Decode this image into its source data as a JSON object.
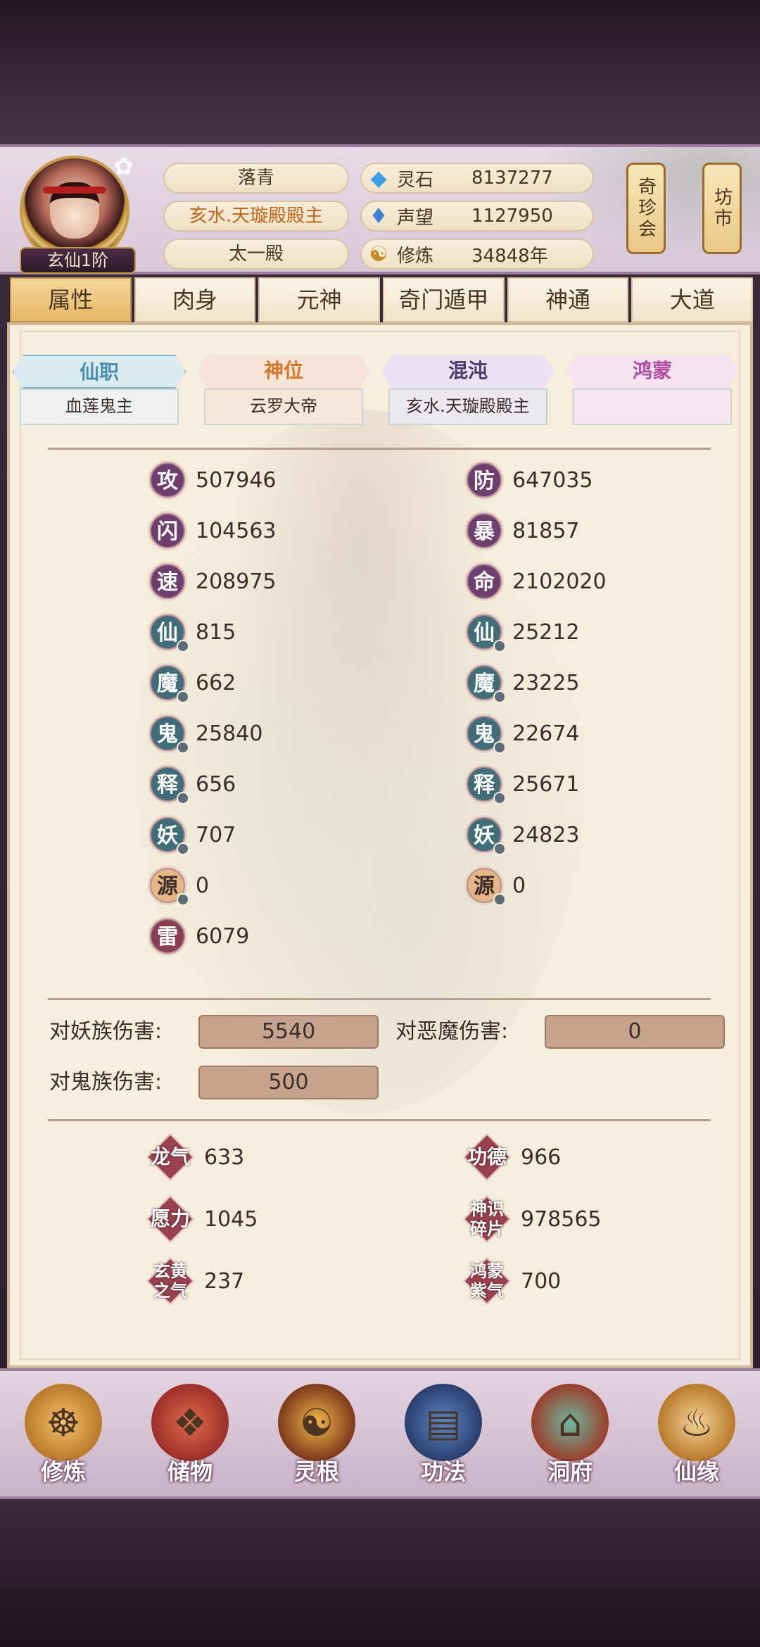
{
  "player": {
    "rank": "玄仙1阶",
    "name": "落青",
    "title": "亥水.天璇殿殿主",
    "faction": "太一殿"
  },
  "resources": [
    {
      "icon": "spirit-stone-icon",
      "label": "灵石",
      "value": "8137277"
    },
    {
      "icon": "reputation-icon",
      "label": "声望",
      "value": "1127950"
    },
    {
      "icon": "cultivation-icon",
      "label": "修炼",
      "value": "34848年"
    }
  ],
  "side_buttons": {
    "treasure": "奇珍会",
    "market": "坊市"
  },
  "tabs": [
    "属性",
    "肉身",
    "元神",
    "奇门遁甲",
    "神通",
    "大道"
  ],
  "titles": [
    {
      "label": "仙职",
      "value": "血莲鬼主"
    },
    {
      "label": "神位",
      "value": "云罗大帝"
    },
    {
      "label": "混沌",
      "value": "亥水.天璇殿殿主"
    },
    {
      "label": "鸿蒙",
      "value": ""
    }
  ],
  "stats_left": [
    {
      "char": "攻",
      "value": "507946"
    },
    {
      "char": "闪",
      "value": "104563"
    },
    {
      "char": "速",
      "value": "208975"
    },
    {
      "char": "仙",
      "value": "815"
    },
    {
      "char": "魔",
      "value": "662"
    },
    {
      "char": "鬼",
      "value": "25840"
    },
    {
      "char": "释",
      "value": "656"
    },
    {
      "char": "妖",
      "value": "707"
    },
    {
      "char": "源",
      "value": "0"
    },
    {
      "char": "雷",
      "value": "6079"
    }
  ],
  "stats_right": [
    {
      "char": "防",
      "value": "647035"
    },
    {
      "char": "暴",
      "value": "81857"
    },
    {
      "char": "命",
      "value": "2102020"
    },
    {
      "char": "仙",
      "value": "25212"
    },
    {
      "char": "魔",
      "value": "23225"
    },
    {
      "char": "鬼",
      "value": "22674"
    },
    {
      "char": "释",
      "value": "25671"
    },
    {
      "char": "妖",
      "value": "24823"
    },
    {
      "char": "源",
      "value": "0"
    }
  ],
  "damage": {
    "demon_race_label": "对妖族伤害:",
    "demon_race_value": "5540",
    "evil_demon_label": "对恶魔伤害:",
    "evil_demon_value": "0",
    "ghost_race_label": "对鬼族伤害:",
    "ghost_race_value": "500"
  },
  "misc": [
    {
      "label": "龙气",
      "value": "633"
    },
    {
      "label": "功德",
      "value": "966"
    },
    {
      "label": "愿力",
      "value": "1045"
    },
    {
      "label": "神识碎片",
      "value": "978565"
    },
    {
      "label": "玄黄之气",
      "value": "237"
    },
    {
      "label": "鸿蒙紫气",
      "value": "700"
    }
  ],
  "nav": [
    "修炼",
    "储物",
    "灵根",
    "功法",
    "洞府",
    "仙缘"
  ]
}
